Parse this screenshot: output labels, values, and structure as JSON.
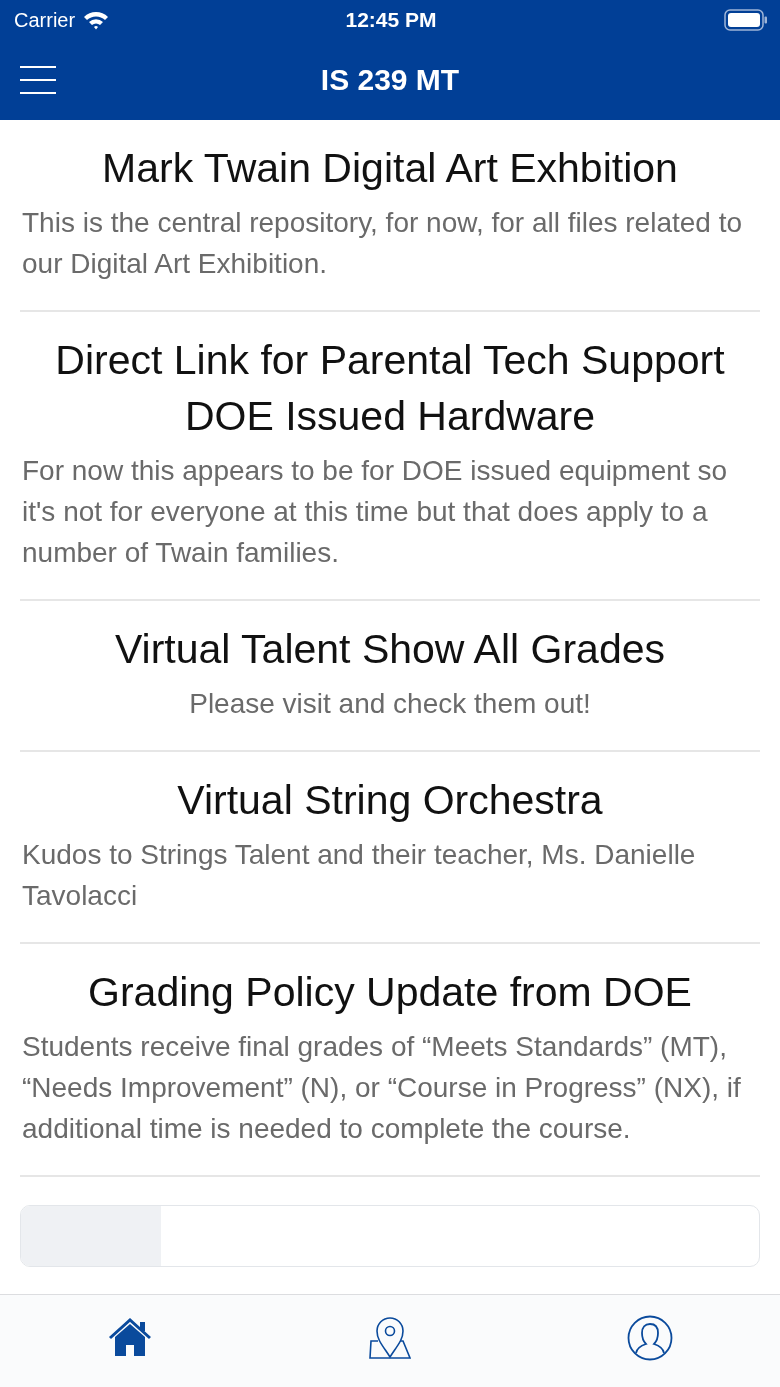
{
  "status_bar": {
    "carrier": "Carrier",
    "time": "12:45 PM"
  },
  "nav_bar": {
    "title": "IS 239 MT"
  },
  "posts": [
    {
      "title": "Mark Twain Digital Art Exhbition",
      "body": "This is the central repository, for now, for all files related to our Digital Art Exhibition.",
      "centered": false
    },
    {
      "title": "Direct Link for Parental Tech Support DOE Issued Hardware",
      "body": "For now this appears to be for DOE issued equipment so it's not for everyone at this time but that does apply to a number of Twain families.",
      "centered": false
    },
    {
      "title": "Virtual Talent Show All Grades",
      "body": "Please visit and check them out!",
      "centered": true
    },
    {
      "title": "Virtual String Orchestra",
      "body": "Kudos to Strings Talent and their teacher, Ms. Danielle Tavolacci",
      "centered": false
    },
    {
      "title": "Grading Policy Update from DOE",
      "body": "Students receive final grades of “Meets Standards” (MT), “Needs Improvement” (N), or “Course in Progress” (NX), if additional time is needed to complete the course.",
      "centered": false
    }
  ],
  "tab_bar": [
    {
      "kind": "home",
      "selected": true
    },
    {
      "kind": "map",
      "selected": false
    },
    {
      "kind": "profile",
      "selected": false
    }
  ]
}
